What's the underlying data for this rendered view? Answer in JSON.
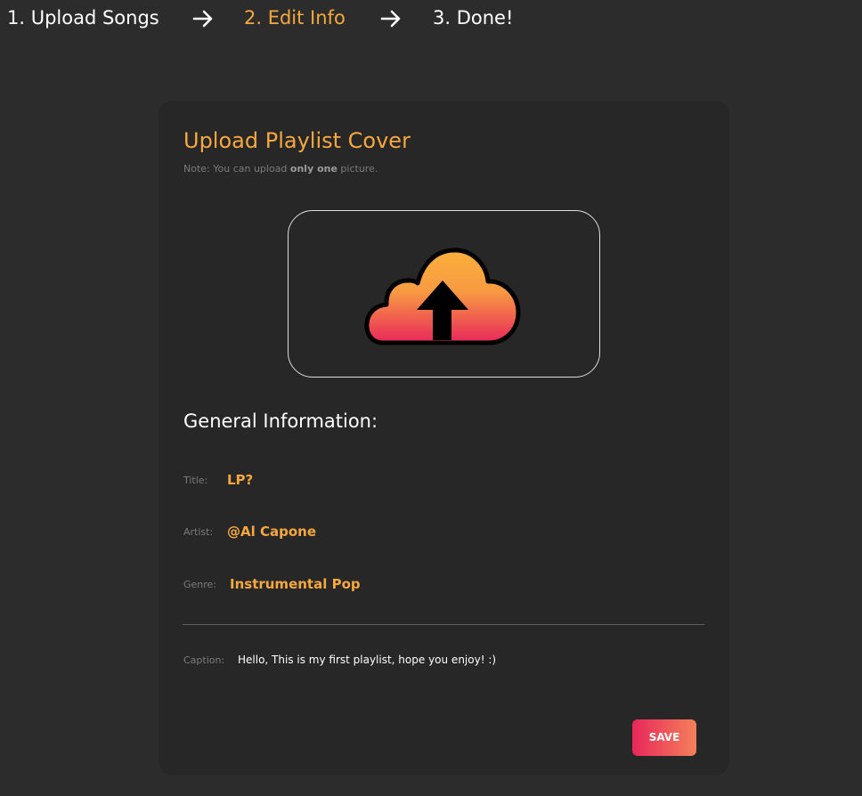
{
  "steps": {
    "step1": "1. Upload Songs",
    "step2": "2. Edit Info",
    "step3": "3. Done!",
    "active_color": "#f6a83e"
  },
  "cover": {
    "title": "Upload Playlist Cover",
    "note_prefix": "Note: You can upload ",
    "note_bold": "only one",
    "note_suffix": " picture.",
    "upload_icon": "cloud-upload-icon",
    "gradient_top": "#fbb03b",
    "gradient_bottom": "#e8275a"
  },
  "general": {
    "heading": "General Information:",
    "title_label": "Title:",
    "title_value": "LP?",
    "artist_label": "Artist:",
    "artist_value": "@Al Capone",
    "genre_label": "Genre:",
    "genre_value": "Instrumental Pop",
    "caption_label": "Caption:",
    "caption_value": "Hello, This is my first playlist, hope you enjoy! :)"
  },
  "actions": {
    "save_label": "SAVE"
  }
}
